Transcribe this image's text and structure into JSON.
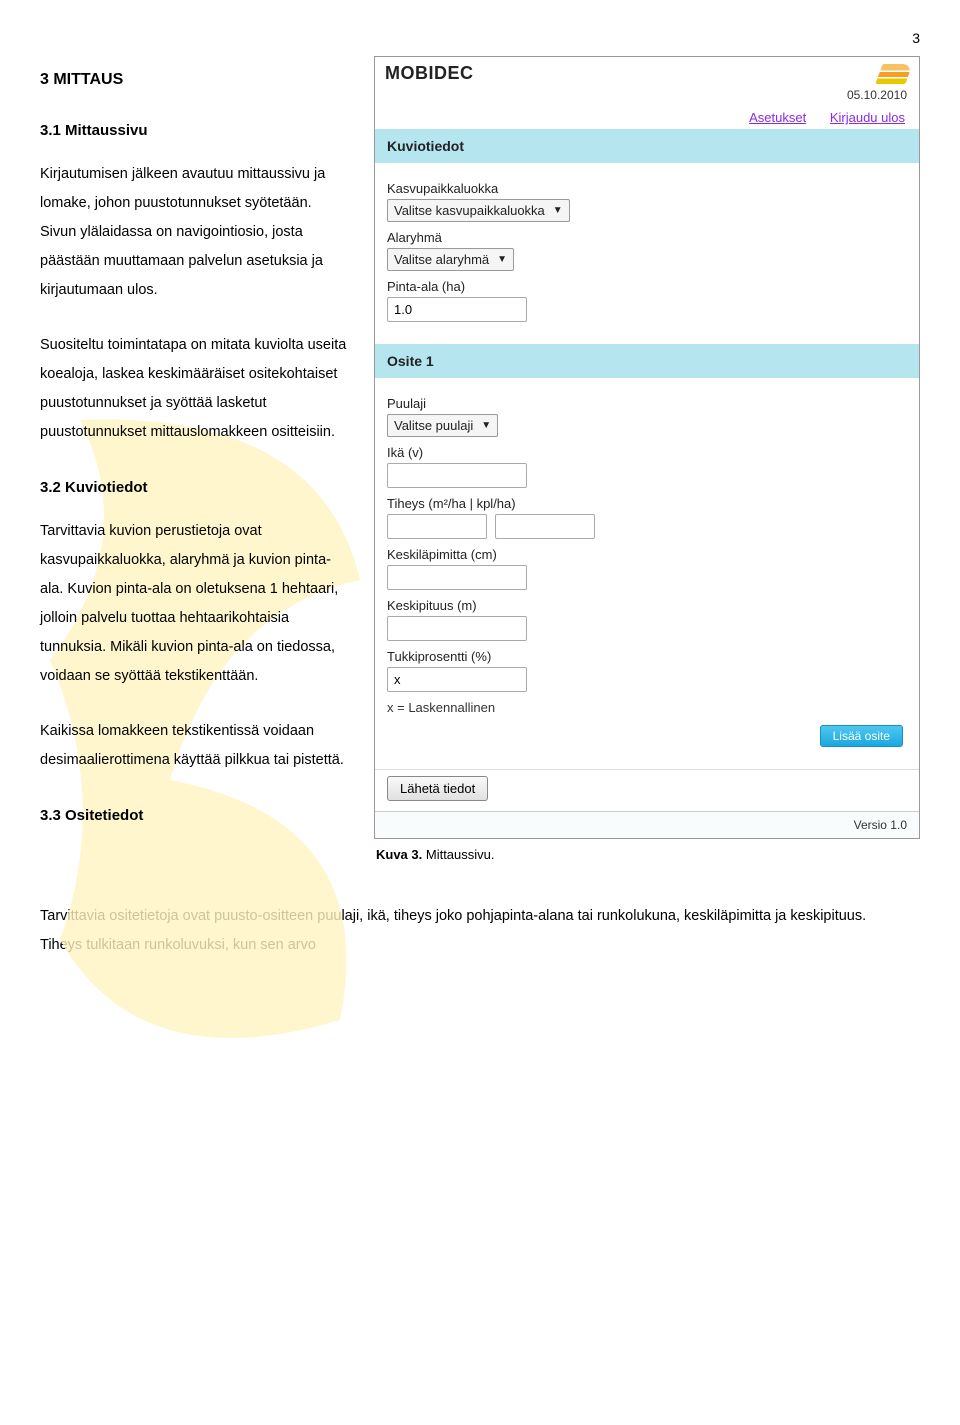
{
  "pageNumber": "3",
  "left": {
    "h2": "3   MITTAUS",
    "h3_1": "3.1   Mittaussivu",
    "p1": "Kirjautumisen jälkeen avautuu mittaussivu ja lomake, johon puustotunnukset syötetään. Sivun ylälaidassa on navigointiosio, josta päästään muuttamaan palvelun asetuksia ja kirjautumaan ulos.",
    "p2": "Suositeltu toimintatapa on mitata kuviolta useita koealoja, laskea keskimääräiset ositekohtaiset puustotunnukset ja syöttää lasketut puustotunnukset mittauslomakkeen ositteisiin.",
    "h3_2": "3.2   Kuviotiedot",
    "p3": "Tarvittavia kuvion perustietoja ovat kasvupaikkaluokka, alaryhmä ja kuvion pinta-ala. Kuvion pinta-ala on oletuksena 1 hehtaari, jolloin palvelu tuottaa hehtaarikohtaisia tunnuksia. Mikäli kuvion pinta-ala on tiedossa, voidaan se syöttää tekstikenttään.",
    "p4": "Kaikissa lomakkeen tekstikentissä voidaan desimaalierottimena käyttää pilkkua tai pistettä.",
    "h3_3": "3.3   Ositetiedot"
  },
  "app": {
    "logo": "MOBIDEC",
    "date": "05.10.2010",
    "nav": {
      "settings": "Asetukset",
      "logout": "Kirjaudu ulos"
    },
    "kuvio": {
      "title": "Kuviotiedot",
      "kasvu_label": "Kasvupaikkaluokka",
      "kasvu_value": "Valitse kasvupaikkaluokka",
      "alaryhma_label": "Alaryhmä",
      "alaryhma_value": "Valitse alaryhmä",
      "pinta_label": "Pinta-ala (ha)",
      "pinta_value": "1.0"
    },
    "osite": {
      "title": "Osite 1",
      "puulaji_label": "Puulaji",
      "puulaji_value": "Valitse puulaji",
      "ika_label": "Ikä (v)",
      "tiheys_label": "Tiheys (m²/ha | kpl/ha)",
      "kl_label": "Keskiläpimitta (cm)",
      "kp_label": "Keskipituus (m)",
      "tukki_label": "Tukkiprosentti (%)",
      "tukki_value": "x",
      "note": "x = Laskennallinen",
      "add_btn": "Lisää osite"
    },
    "submit": "Lähetä tiedot",
    "version": "Versio 1.0"
  },
  "caption_bold": "Kuva 3.",
  "caption_rest": " Mittaussivu.",
  "bottom": "Tarvittavia ositetietoja ovat puusto-ositteen puulaji, ikä, tiheys joko pohjapinta-alana tai runkolukuna, keskiläpimitta ja keskipituus. Tiheys tulkitaan runkoluvuksi, kun sen arvo"
}
